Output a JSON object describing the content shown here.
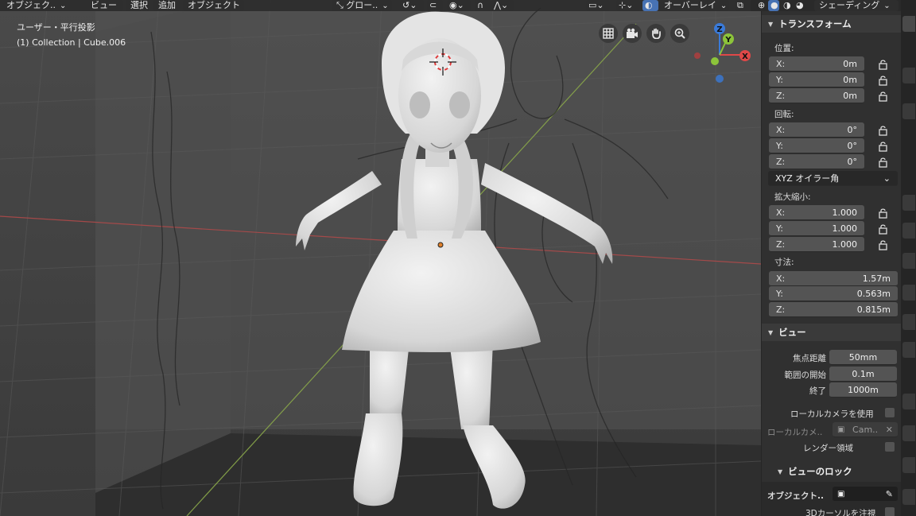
{
  "header": {
    "mode_label": "オブジェク..",
    "menus": [
      "ビュー",
      "選択",
      "追加",
      "オブジェクト"
    ],
    "transform_orientation": "グロー..",
    "overlay_label": "オーバーレイ",
    "shading_label": "シェーディング"
  },
  "viewport": {
    "view_name": "ユーザー・平行投影",
    "collection_info": "(1) Collection | Cube.006"
  },
  "gizmo": {
    "z": "Z",
    "y": "Y",
    "x": "X"
  },
  "sidebar": {
    "transform": {
      "title": "トランスフォーム",
      "location_label": "位置:",
      "location": [
        {
          "axis": "X:",
          "value": "0m"
        },
        {
          "axis": "Y:",
          "value": "0m"
        },
        {
          "axis": "Z:",
          "value": "0m"
        }
      ],
      "rotation_label": "回転:",
      "rotation": [
        {
          "axis": "X:",
          "value": "0°"
        },
        {
          "axis": "Y:",
          "value": "0°"
        },
        {
          "axis": "Z:",
          "value": "0°"
        }
      ],
      "rotation_mode": "XYZ オイラー角",
      "scale_label": "拡大縮小:",
      "scale": [
        {
          "axis": "X:",
          "value": "1.000"
        },
        {
          "axis": "Y:",
          "value": "1.000"
        },
        {
          "axis": "Z:",
          "value": "1.000"
        }
      ],
      "dimensions_label": "寸法:",
      "dimensions": [
        {
          "axis": "X:",
          "value": "1.57m"
        },
        {
          "axis": "Y:",
          "value": "0.563m"
        },
        {
          "axis": "Z:",
          "value": "0.815m"
        }
      ]
    },
    "view": {
      "title": "ビュー",
      "focal_label": "焦点距離",
      "focal_value": "50mm",
      "clip_start_label": "範囲の開始",
      "clip_start_value": "0.1m",
      "clip_end_label": "終了",
      "clip_end_value": "1000m",
      "local_camera_label": "ローカルカメラを使用",
      "local_camera_field_label": "ローカルカメ..",
      "local_camera_value": "Cam..",
      "render_region_label": "レンダー領域",
      "lock_title": "ビューのロック",
      "lock_object_label": "オブジェクト..",
      "lock_cursor_label": "3Dカーソルを注視"
    }
  },
  "colors": {
    "x_axis": "#e04848",
    "y_axis": "#8cc43a",
    "z_axis": "#3a7ad8",
    "accent": "#4772b3"
  }
}
